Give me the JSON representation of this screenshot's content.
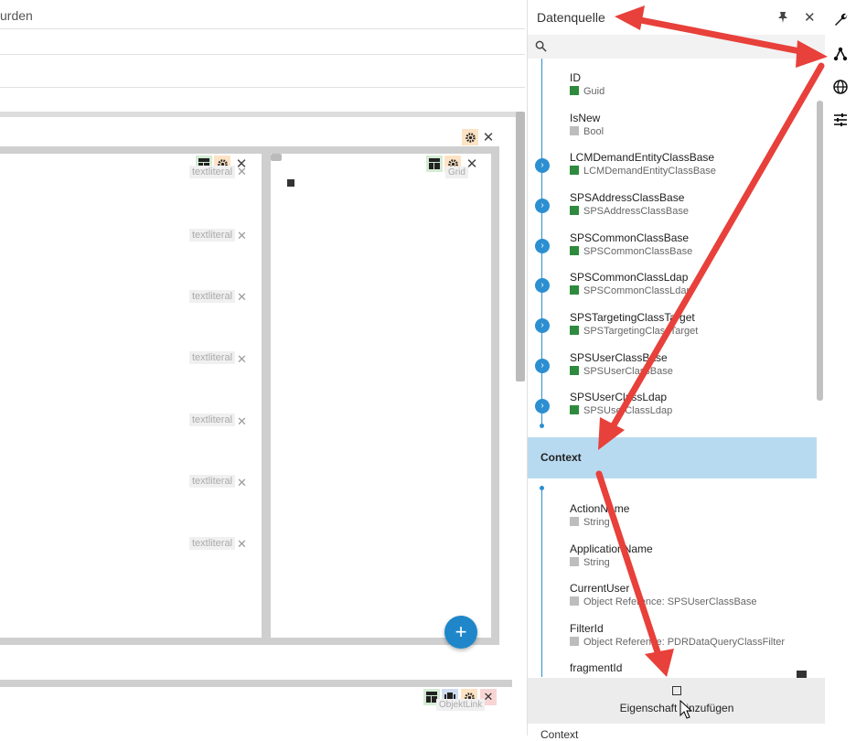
{
  "form": {
    "title_fragment": "urden"
  },
  "canvas": {
    "literals": [
      "textliteral",
      "textliteral",
      "textliteral",
      "textliteral",
      "textliteral",
      "textliteral",
      "textliteral",
      "textliteral"
    ],
    "grid_hint": "Grid",
    "link_hint": "ObjektLink",
    "add_label": "+"
  },
  "datasource": {
    "title": "Datenquelle",
    "items": [
      {
        "name": "ID",
        "type": "Guid",
        "color": "green",
        "expandable": false
      },
      {
        "name": "IsNew",
        "type": "Bool",
        "color": "gray",
        "expandable": false
      },
      {
        "name": "LCMDemandEntityClassBase",
        "type": "LCMDemandEntityClassBase",
        "color": "green",
        "expandable": true
      },
      {
        "name": "SPSAddressClassBase",
        "type": "SPSAddressClassBase",
        "color": "green",
        "expandable": true
      },
      {
        "name": "SPSCommonClassBase",
        "type": "SPSCommonClassBase",
        "color": "green",
        "expandable": true
      },
      {
        "name": "SPSCommonClassLdap",
        "type": "SPSCommonClassLdap",
        "color": "green",
        "expandable": true
      },
      {
        "name": "SPSTargetingClassTarget",
        "type": "SPSTargetingClassTarget",
        "color": "green",
        "expandable": true
      },
      {
        "name": "SPSUserClassBase",
        "type": "SPSUserClassBase",
        "color": "green",
        "expandable": true
      },
      {
        "name": "SPSUserClassLdap",
        "type": "SPSUserClassLdap",
        "color": "green",
        "expandable": true
      }
    ],
    "context_label": "Context",
    "context_items": [
      {
        "name": "ActionName",
        "type": "String",
        "color": "gray"
      },
      {
        "name": "ApplicationName",
        "type": "String",
        "color": "gray"
      },
      {
        "name": "CurrentUser",
        "type": "Object Reference: SPSUserClassBase",
        "color": "gray"
      },
      {
        "name": "FilterId",
        "type": "Object Reference: PDRDataQueryClassFilter",
        "color": "gray"
      },
      {
        "name": "fragmentId",
        "type": "",
        "color": "gray"
      }
    ],
    "add_property_label": "Eigenschaft hinzufügen",
    "bottom_context_label": "Context"
  },
  "colors": {
    "accent": "#2b8fd1",
    "context_highlight": "#b8daf0",
    "type_green": "#2e8b3e",
    "annotation_red": "#e8403a"
  }
}
